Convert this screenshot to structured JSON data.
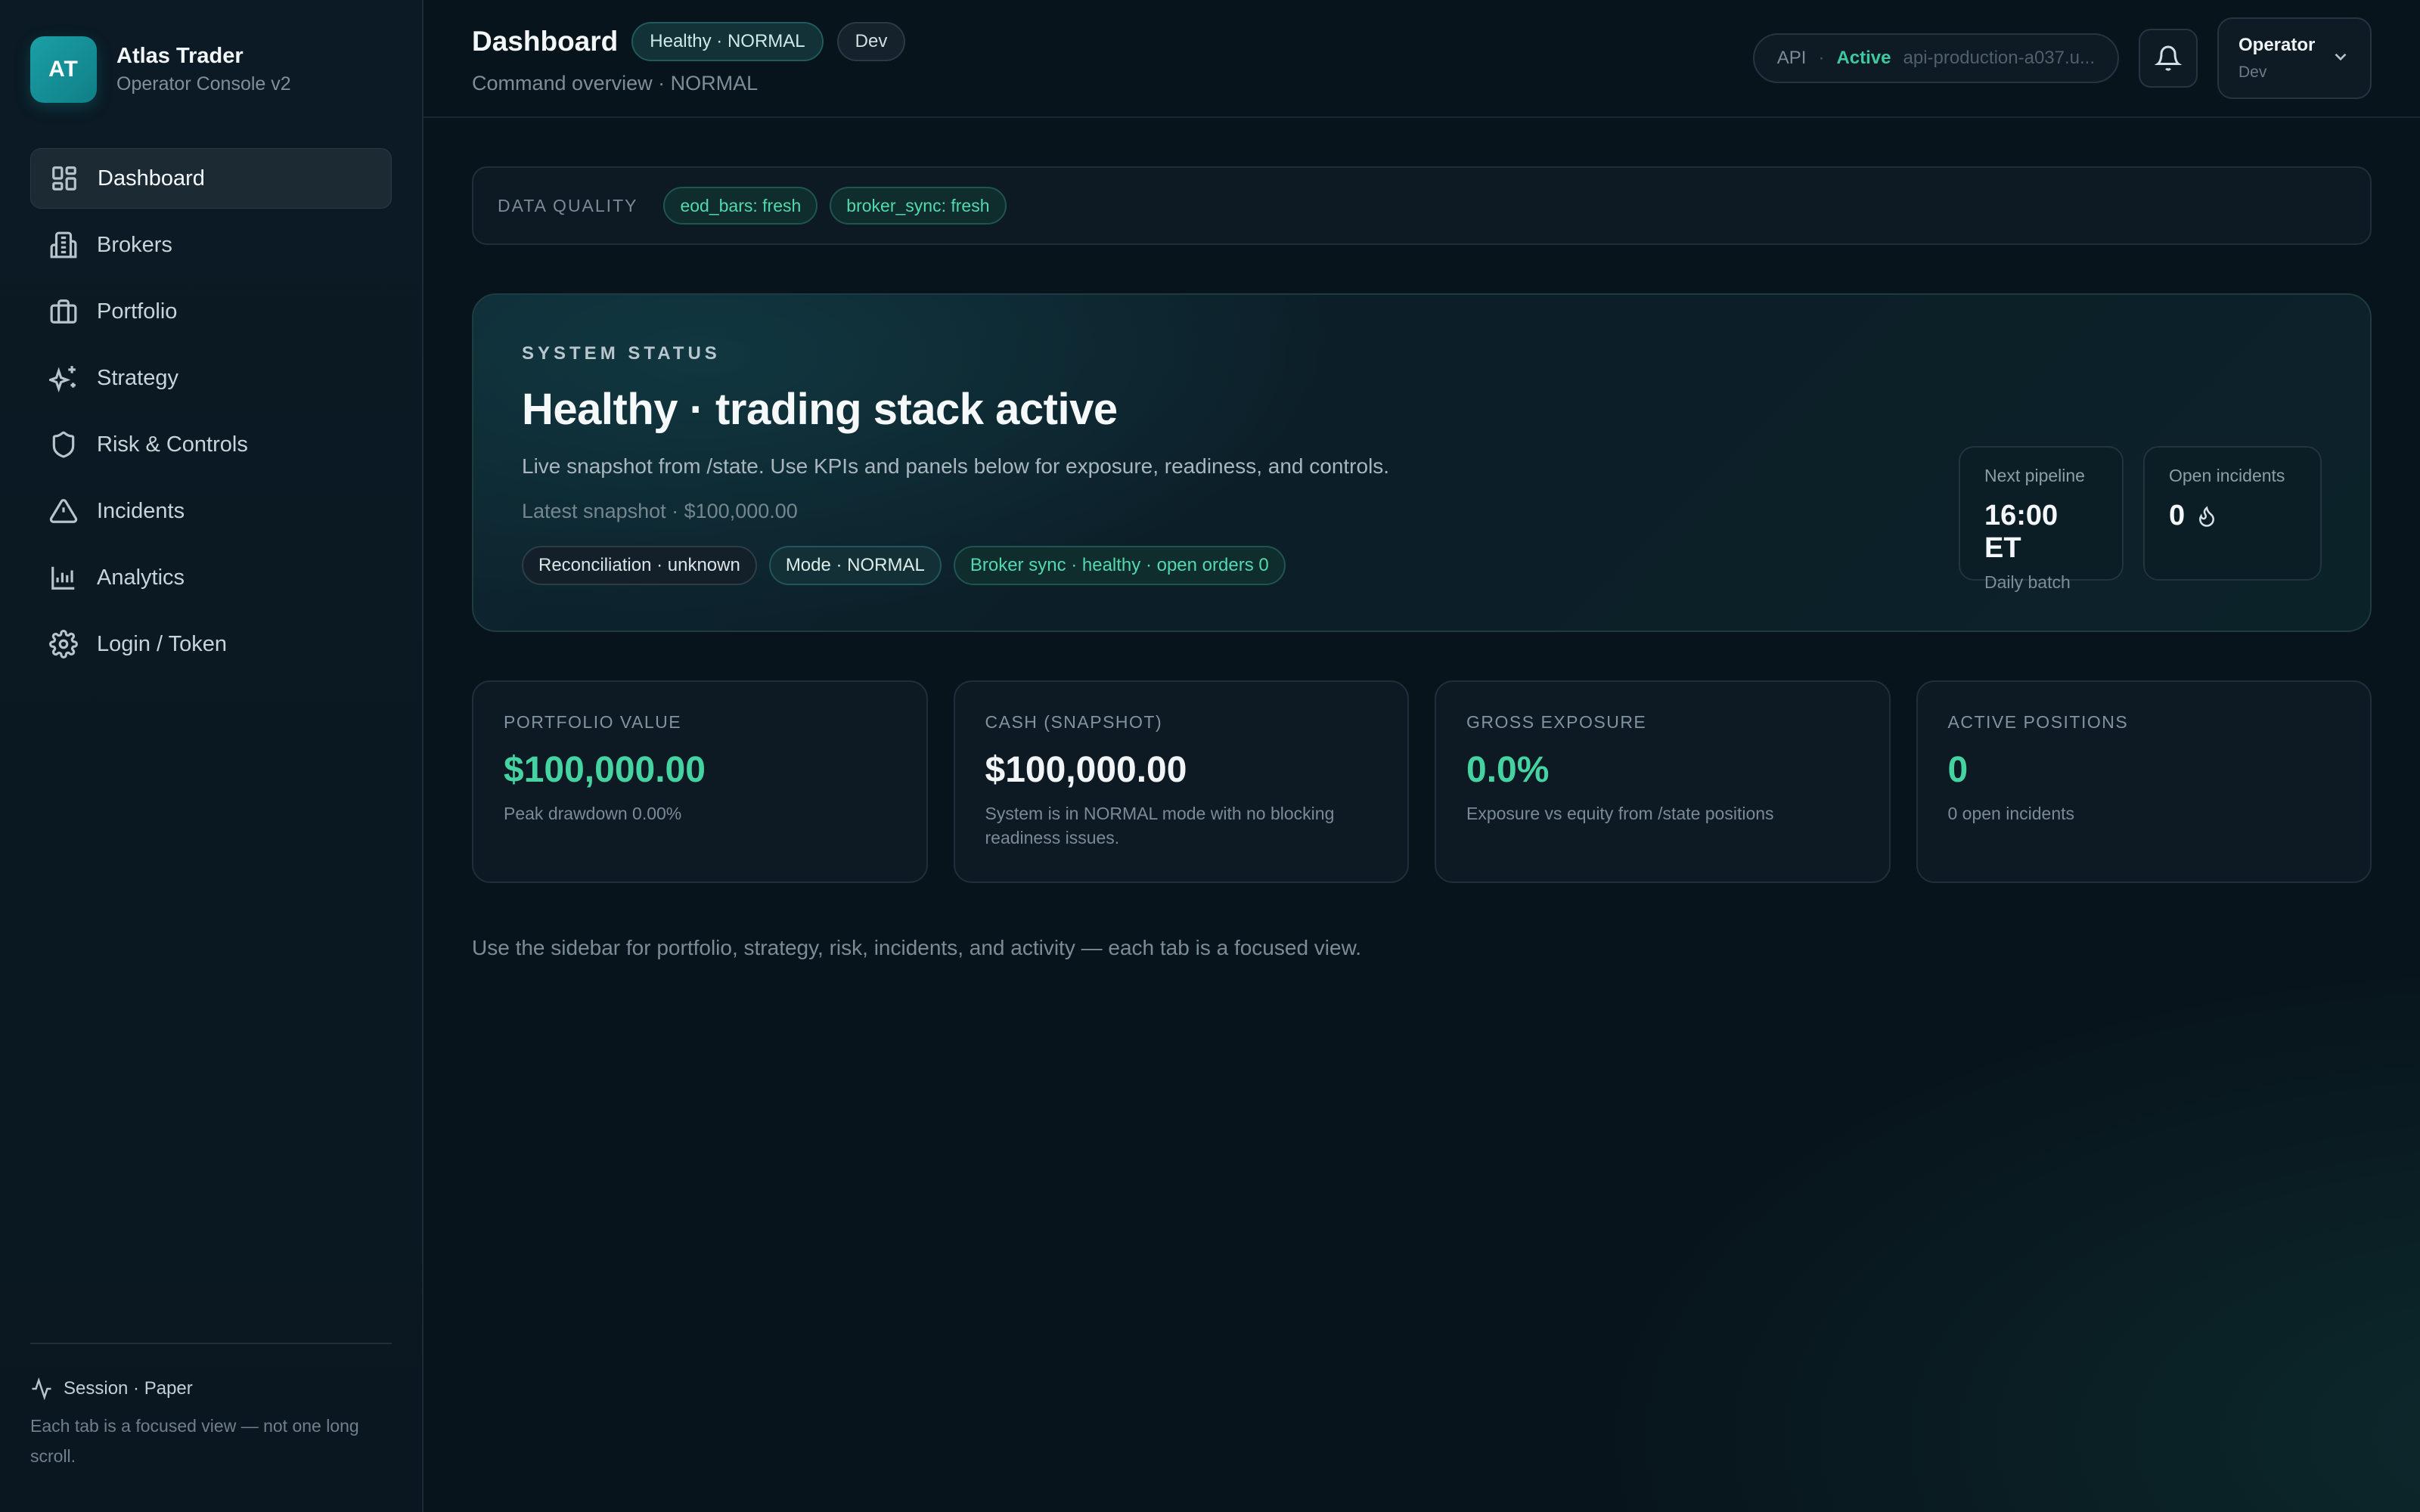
{
  "brand": {
    "initials": "AT",
    "name": "Atlas Trader",
    "subtitle": "Operator Console v2"
  },
  "sidebar": {
    "items": [
      {
        "label": "Dashboard",
        "icon": "grid-icon",
        "active": true
      },
      {
        "label": "Brokers",
        "icon": "building-icon"
      },
      {
        "label": "Portfolio",
        "icon": "briefcase-icon"
      },
      {
        "label": "Strategy",
        "icon": "sparkle-icon"
      },
      {
        "label": "Risk & Controls",
        "icon": "shield-icon"
      },
      {
        "label": "Incidents",
        "icon": "alert-triangle-icon"
      },
      {
        "label": "Analytics",
        "icon": "bar-chart-icon"
      },
      {
        "label": "Login / Token",
        "icon": "gear-icon"
      }
    ],
    "footer": {
      "session": "Session · Paper",
      "note": "Each tab is a focused view — not one long scroll."
    }
  },
  "header": {
    "title": "Dashboard",
    "badge_health": "Healthy · NORMAL",
    "badge_env": "Dev",
    "subtitle": "Command overview · NORMAL",
    "api": {
      "label": "API",
      "separator": "·",
      "status": "Active",
      "host": "api-production-a037.u..."
    },
    "operator": {
      "name": "Operator",
      "role": "Dev"
    }
  },
  "data_quality": {
    "label": "DATA QUALITY",
    "items": [
      "eod_bars: fresh",
      "broker_sync: fresh"
    ]
  },
  "system_status": {
    "eyebrow": "SYSTEM STATUS",
    "headline": "Healthy · trading stack active",
    "description": "Live snapshot from /state. Use KPIs and panels below for exposure, readiness, and controls.",
    "snapshot": "Latest snapshot · $100,000.00",
    "tags": [
      "Reconciliation · unknown",
      "Mode · NORMAL",
      "Broker sync · healthy · open orders 0"
    ],
    "next_pipeline": {
      "label": "Next pipeline",
      "value": "16:00 ET",
      "note": "Daily batch"
    },
    "open_incidents": {
      "label": "Open incidents",
      "value": "0"
    }
  },
  "kpis": [
    {
      "label": "PORTFOLIO VALUE",
      "value": "$100,000.00",
      "note": "Peak drawdown 0.00%",
      "accent": "#46d3a2"
    },
    {
      "label": "CASH (SNAPSHOT)",
      "value": "$100,000.00",
      "note": "System is in NORMAL mode with no blocking readiness issues.",
      "accent": "#f1f5f7"
    },
    {
      "label": "GROSS EXPOSURE",
      "value": "0.0%",
      "note": "Exposure vs equity from /state positions",
      "accent": "#46d3a2"
    },
    {
      "label": "ACTIVE POSITIONS",
      "value": "0",
      "note": "0 open incidents",
      "accent": "#46d3a2"
    }
  ],
  "footer_hint": "Use the sidebar for portfolio, strategy, risk, incidents, and activity — each tab is a focused view.",
  "colors": {
    "accent": "#46d3a2",
    "background": "#08141c",
    "brand": "#1b9fa6"
  }
}
